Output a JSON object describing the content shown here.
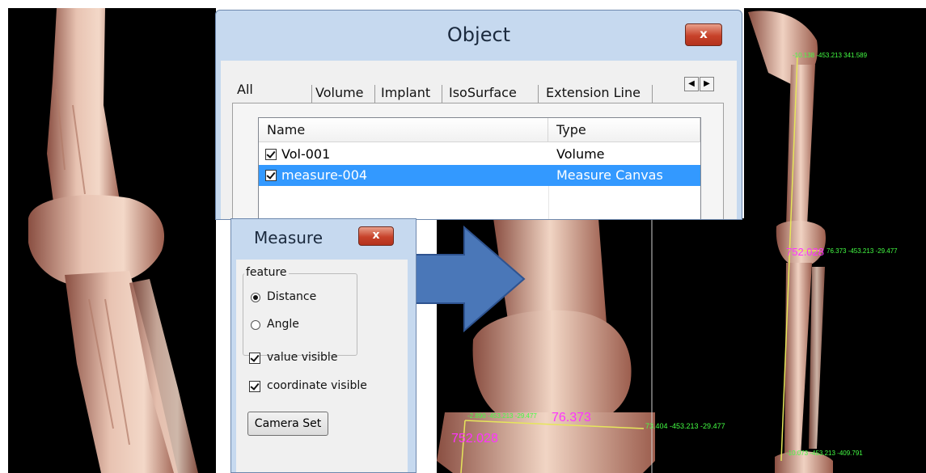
{
  "object_window": {
    "title": "Object",
    "close_glyph": "x",
    "tabs": [
      {
        "label": "All"
      },
      {
        "label": "Volume"
      },
      {
        "label": "Implant"
      },
      {
        "label": "IsoSurface"
      },
      {
        "label": "Extension Line"
      }
    ],
    "tab_scroll": {
      "left_glyph": "◀",
      "right_glyph": "▶"
    },
    "table": {
      "columns": [
        "Name",
        "Type"
      ],
      "rows": [
        {
          "name": "Vol-001",
          "type": "Volume",
          "checked": true,
          "selected": false
        },
        {
          "name": "measure-004",
          "type": "Measure Canvas",
          "checked": true,
          "selected": true
        }
      ]
    }
  },
  "measure_window": {
    "title": "Measure",
    "close_glyph": "x",
    "group_label": "feature",
    "options": [
      {
        "label": "Distance",
        "selected": true
      },
      {
        "label": "Angle",
        "selected": false
      }
    ],
    "checkboxes": [
      {
        "label": "value visible",
        "checked": true
      },
      {
        "label": "coordinate visible",
        "checked": true
      }
    ],
    "camera_button": "Camera Set"
  },
  "arrow_color": "#4a77b8",
  "measure_view": {
    "value_text": "76.373",
    "total_text": "752.028",
    "coord_left": "-2.890 -453.213 -29.477",
    "coord_right": "73.404 -453.213 -29.477",
    "label_color": "#ff33ff",
    "coord_color": "#44ff44"
  },
  "leg_view": {
    "coord_top": "-10.138 -453.213 341.589",
    "coord_mid": "76.373 -453.213 -29.477",
    "value_text": "752.028",
    "coord_bottom": "-10.073 -453.213 -409.791"
  }
}
